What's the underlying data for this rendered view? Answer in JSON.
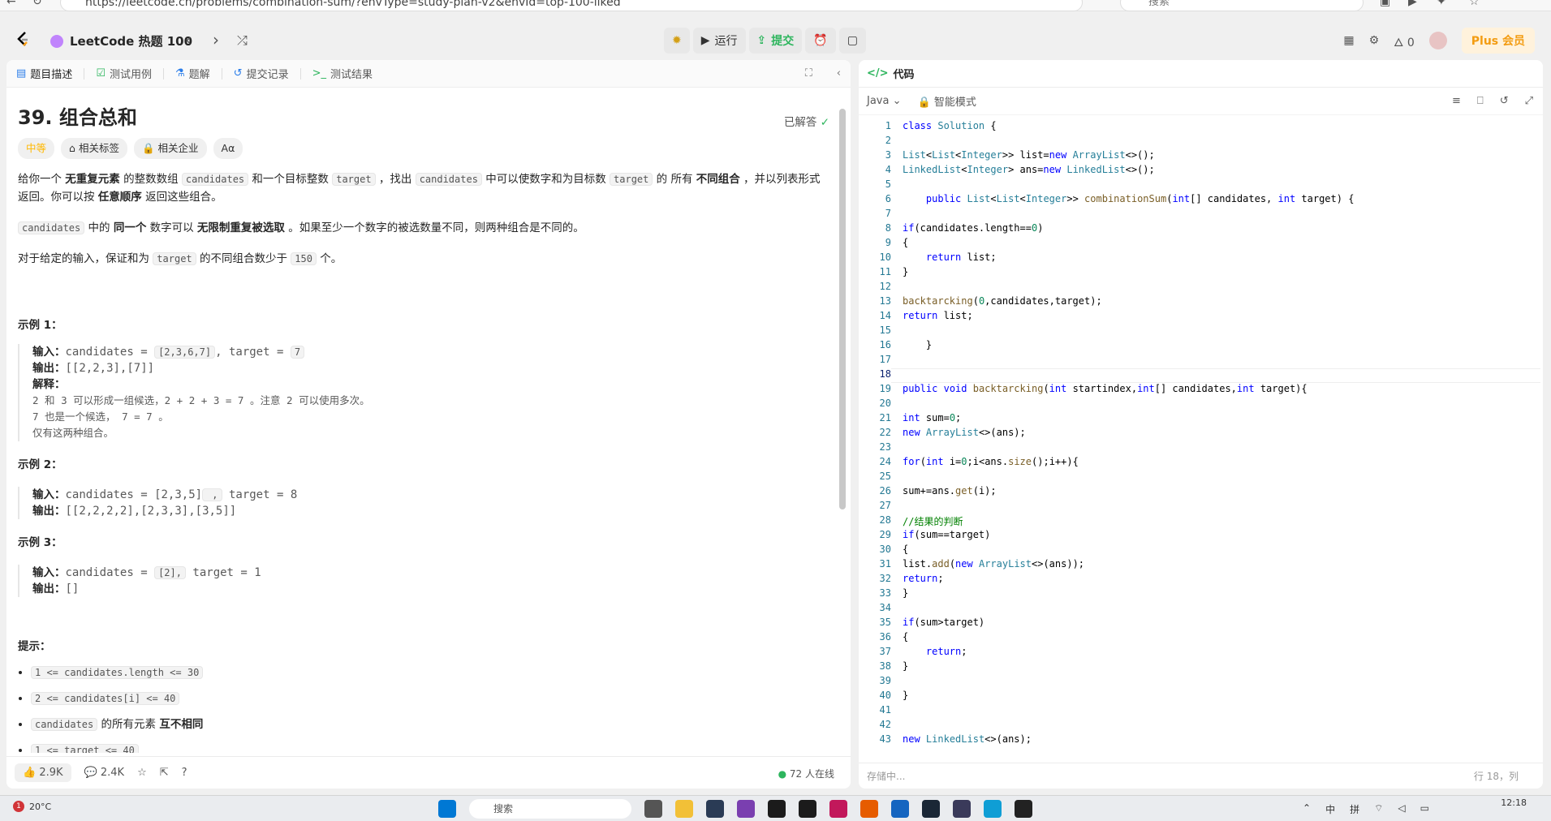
{
  "browser": {
    "url": "https://leetcode.cn/problems/combination-sum/?envType=study-plan-v2&envId=top-100-liked",
    "search_placeholder": "搜索"
  },
  "nav": {
    "study_plan": "LeetCode 热题 100",
    "run_label": "运行",
    "submit_label": "提交",
    "streak_count": "0",
    "plus_label": "Plus 会员"
  },
  "left_tabs": [
    "题目描述",
    "测试用例",
    "题解",
    "提交记录",
    "测试结果"
  ],
  "problem": {
    "title": "39. 组合总和",
    "solved_label": "已解答",
    "difficulty": "中等",
    "tag_topics": "相关标签",
    "tag_companies": "相关企业",
    "tag_font": "Aα",
    "p1_a": "给你一个 ",
    "p1_b": "无重复元素",
    "p1_c": " 的整数数组 ",
    "p1_code1": "candidates",
    "p1_d": " 和一个目标整数 ",
    "p1_code2": "target",
    "p1_e": " ，找出 ",
    "p1_code3": "candidates",
    "p1_f": " 中可以使数字和为目标数 ",
    "p1_code4": "target",
    "p1_g": " 的 所有 ",
    "p1_h": "不同组合",
    "p1_i": " ，并以列表形式返回。你可以按 ",
    "p1_j": "任意顺序",
    "p1_k": " 返回这些组合。",
    "p2_code": "candidates",
    "p2_a": " 中的 ",
    "p2_b": "同一个",
    "p2_c": " 数字可以 ",
    "p2_d": "无限制重复被选取",
    "p2_e": " 。如果至少一个数字的被选数量不同，则两种组合是不同的。",
    "p3_a": "对于给定的输入，保证和为 ",
    "p3_code1": "target",
    "p3_b": " 的不同组合数少于 ",
    "p3_code2": "150",
    "p3_c": " 个。",
    "ex1_title": "示例 1：",
    "ex1_input_label": "输入：",
    "ex1_input_a": "candidates = ",
    "ex1_input_code1": "[2,3,6,7]",
    "ex1_input_b": ", target = ",
    "ex1_input_code2": "7",
    "ex1_output_label": "输出：",
    "ex1_output": "[[2,2,3],[7]]",
    "ex1_explain_label": "解释：",
    "ex1_explain_1": "2 和 3 可以形成一组候选，2 + 2 + 3 = 7 。注意 2 可以使用多次。",
    "ex1_explain_2": "7 也是一个候选， 7 = 7 。",
    "ex1_explain_3": "仅有这两种组合。",
    "ex2_title": "示例 2：",
    "ex2_input_label": "输入：",
    "ex2_input_a": "candidates = [2,3,5]",
    "ex2_input_code": " ,",
    "ex2_input_b": " target = 8",
    "ex2_output_label": "输出：",
    "ex2_output": "[[2,2,2,2],[2,3,3],[3,5]]",
    "ex3_title": "示例 3：",
    "ex3_input_label": "输入：",
    "ex3_input_a": "candidates = ",
    "ex3_input_code": "[2],",
    "ex3_input_b": " target = 1",
    "ex3_output_label": "输出：",
    "ex3_output": "[]",
    "hints_title": "提示：",
    "hint1": "1 <= candidates.length <= 30",
    "hint2": "2 <= candidates[i] <= 40",
    "hint3_code": "candidates",
    "hint3_a": " 的所有元素 ",
    "hint3_b": "互不相同",
    "hint4": "1 <= target <= 40"
  },
  "left_bottom": {
    "likes": "2.9K",
    "comments": "2.4K",
    "online": "72 人在线"
  },
  "code": {
    "tab_label": "代码",
    "language": "Java",
    "mode": "智能模式",
    "status": "存储中...",
    "position": "行 18，列"
  },
  "taskbar": {
    "temp": "20°C",
    "weather_badge": "1",
    "search": "搜索",
    "lang": "中",
    "ime": "拼",
    "time": "12:18"
  }
}
